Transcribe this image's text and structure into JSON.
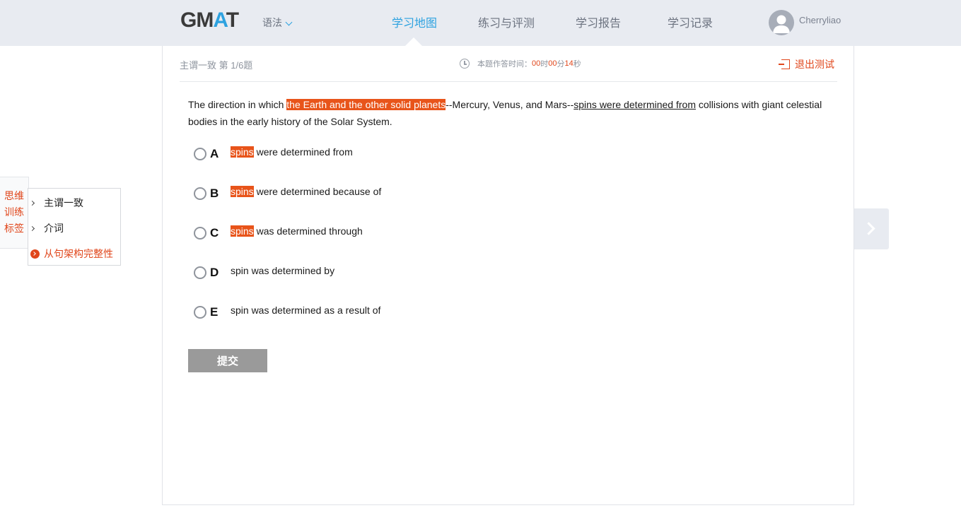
{
  "header": {
    "logo_prefix": "GM",
    "logo_accent": "A",
    "logo_suffix": "T",
    "subject": "语法",
    "nav": [
      {
        "label": "学习地图",
        "active": true
      },
      {
        "label": "练习与评测",
        "active": false
      },
      {
        "label": "学习报告",
        "active": false
      },
      {
        "label": "学习记录",
        "active": false
      }
    ],
    "username": "Cherryliao"
  },
  "quiz": {
    "topic": "主谓一致  第 1/6题",
    "timer_label": "本题作答时间：",
    "timer_hours": "00",
    "timer_h_unit": "时",
    "timer_minutes": "00",
    "timer_m_unit": "分",
    "timer_seconds": "14",
    "timer_s_unit": "秒",
    "exit_label": "退出测试",
    "question": {
      "part1": "The direction in which ",
      "highlight": "the Earth and the other solid planets",
      "part2": "--Mercury, Venus, and Mars--",
      "underlined": "spins were determined from",
      "part3": " collisions with giant celestial bodies in the early history of the Solar System."
    },
    "options": [
      {
        "letter": "A",
        "highlight": "spins",
        "text": " were determined from"
      },
      {
        "letter": "B",
        "highlight": "spins",
        "text": " were determined because of"
      },
      {
        "letter": "C",
        "highlight": "spins",
        "text": " was determined through"
      },
      {
        "letter": "D",
        "highlight": "",
        "text": "spin was determined by"
      },
      {
        "letter": "E",
        "highlight": "",
        "text": "spin was determined as a result of"
      }
    ],
    "submit_label": "提交"
  },
  "side_tags": {
    "tab_label": "思维训练标签",
    "items": [
      {
        "label": "主谓一致",
        "active": false
      },
      {
        "label": "介词",
        "active": false
      },
      {
        "label": "从句架构完整性",
        "active": true
      }
    ]
  },
  "colors": {
    "accent_blue": "#2da2e0",
    "accent_orange": "#e0461b",
    "highlight": "#e8541a",
    "header_bg": "#e8ebf1"
  },
  "icons": {
    "subject_dropdown": "chevron-down-icon",
    "timer": "clock-icon",
    "exit": "exit-icon",
    "next": "chevron-right-icon",
    "avatar": "user-avatar-icon"
  }
}
